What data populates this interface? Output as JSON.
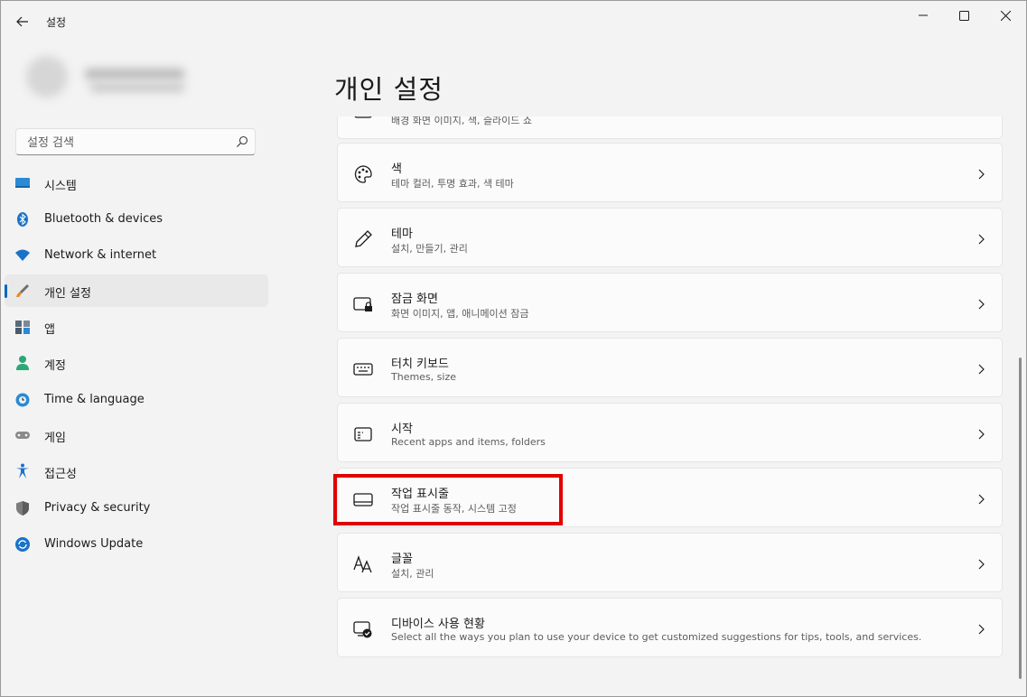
{
  "window": {
    "app_title": "설정",
    "icons": {
      "back": "back-arrow-icon",
      "minimize": "minimize-icon",
      "maximize": "maximize-icon",
      "close": "close-icon"
    }
  },
  "search": {
    "placeholder": "설정 검색",
    "icon": "search-icon"
  },
  "sidebar": {
    "items": [
      {
        "label": "시스템",
        "icon": "system-display-icon",
        "selected": false
      },
      {
        "label": "Bluetooth & devices",
        "icon": "bluetooth-icon",
        "selected": false
      },
      {
        "label": "Network & internet",
        "icon": "wifi-icon",
        "selected": false
      },
      {
        "label": "개인 설정",
        "icon": "brush-icon",
        "selected": true
      },
      {
        "label": "앱",
        "icon": "apps-icon",
        "selected": false
      },
      {
        "label": "계정",
        "icon": "account-icon",
        "selected": false
      },
      {
        "label": "Time & language",
        "icon": "globe-clock-icon",
        "selected": false
      },
      {
        "label": "게임",
        "icon": "gamepad-icon",
        "selected": false
      },
      {
        "label": "접근성",
        "icon": "accessibility-icon",
        "selected": false
      },
      {
        "label": "Privacy & security",
        "icon": "shield-icon",
        "selected": false
      },
      {
        "label": "Windows Update",
        "icon": "update-icon",
        "selected": false
      }
    ]
  },
  "main": {
    "title": "개인 설정",
    "cards": [
      {
        "title": "",
        "subtitle": "배경 화면 이미지, 색, 슬라이드 쇼",
        "icon": "background-icon"
      },
      {
        "title": "색",
        "subtitle": "테마 컬러, 투명 효과, 색 테마",
        "icon": "palette-icon"
      },
      {
        "title": "테마",
        "subtitle": "설치, 만들기, 관리",
        "icon": "pen-icon"
      },
      {
        "title": "잠금 화면",
        "subtitle": "화면 이미지, 앱, 애니메이션 잠금",
        "icon": "lock-screen-icon"
      },
      {
        "title": "터치 키보드",
        "subtitle": "Themes, size",
        "icon": "keyboard-icon"
      },
      {
        "title": "시작",
        "subtitle": "Recent apps and items, folders",
        "icon": "start-menu-icon"
      },
      {
        "title": "작업 표시줄",
        "subtitle": "작업 표시줄 동작, 시스템 고정",
        "icon": "taskbar-icon",
        "highlighted": true
      },
      {
        "title": "글꼴",
        "subtitle": "설치, 관리",
        "icon": "font-icon"
      },
      {
        "title": "디바이스 사용 현황",
        "subtitle": "Select all the ways you plan to use your device to get customized suggestions for tips, tools, and services.",
        "icon": "device-usage-icon"
      }
    ]
  },
  "colors": {
    "accent": "#0067c0",
    "highlight": "#e20000",
    "background": "#f3f3f3",
    "card": "#fbfbfb"
  }
}
